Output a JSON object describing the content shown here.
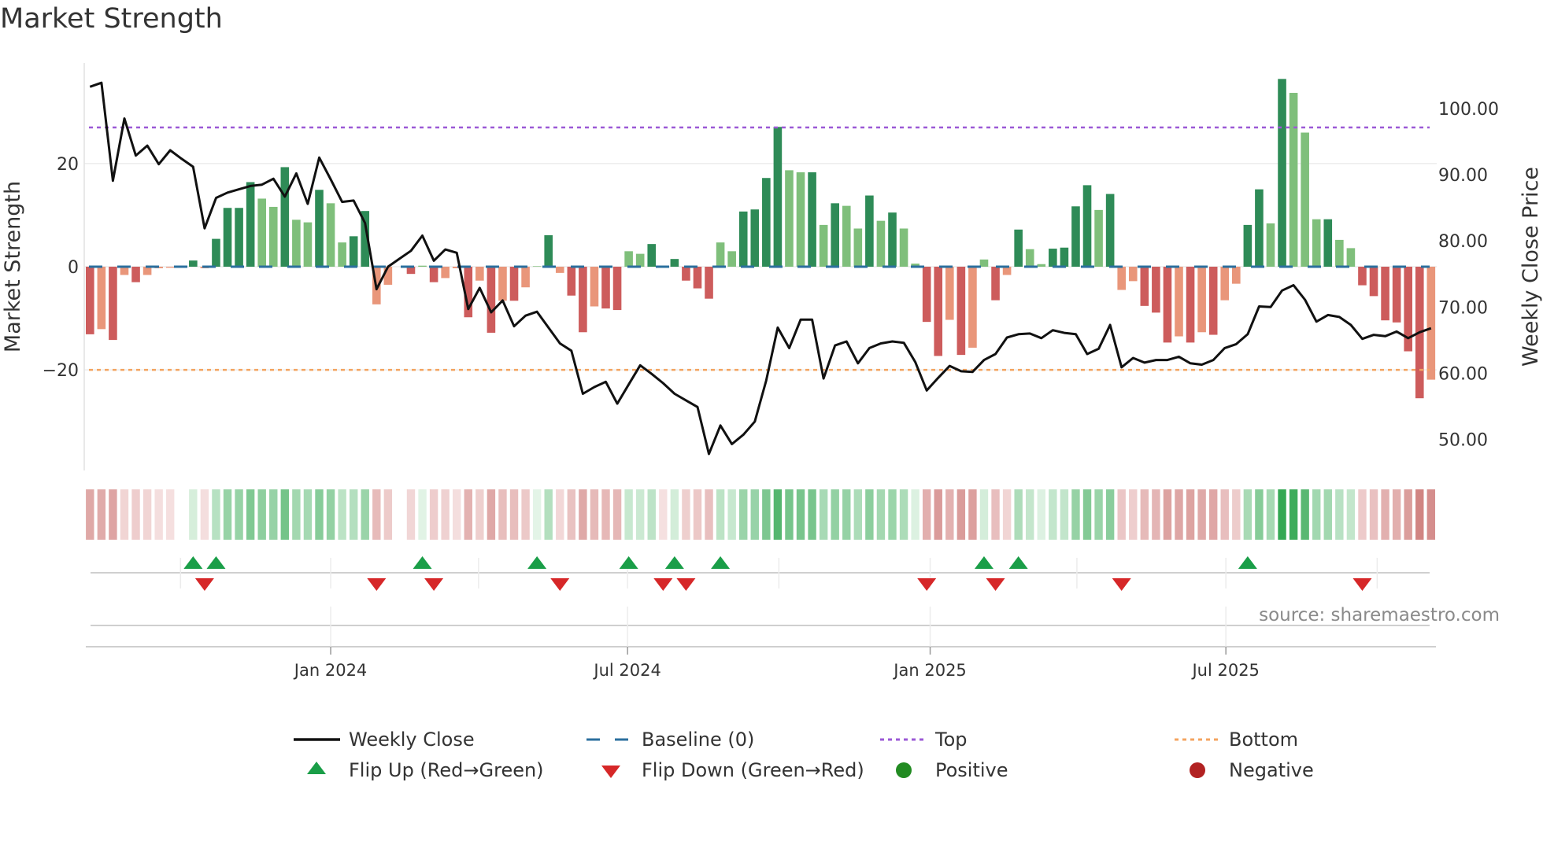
{
  "title": "Market Strength",
  "source": "source: sharemaestro.com",
  "colors": {
    "pos_strong": "#2e8b57",
    "pos_weak": "#7fbf7b",
    "neg_strong": "#cd5c5c",
    "neg_weak": "#e9967a",
    "line": "#111111",
    "baseline": "#2b6f9e",
    "top": "#9b59d6",
    "bottom": "#f4a460",
    "flip_up": "#1a9e48",
    "flip_down": "#d62728",
    "positive": "#228b22",
    "negative": "#b22222"
  },
  "legend": {
    "weekly_close": "Weekly Close",
    "baseline": "Baseline (0)",
    "top": "Top",
    "bottom": "Bottom",
    "flip_up": "Flip Up (Red→Green)",
    "flip_down": "Flip Down (Green→Red)",
    "positive": "Positive",
    "negative": "Negative"
  },
  "chart_data": {
    "type": "bar+line",
    "title": "Market Strength",
    "ylabel": "Market Strength",
    "ylabel_right": "Weekly Close Price",
    "ylim": [
      -39.5,
      39.5
    ],
    "ylim_right": [
      45.3,
      106.9
    ],
    "yticks": [
      20,
      0,
      -20
    ],
    "ytick_labels": [
      "20",
      "0",
      "−20"
    ],
    "yticks_right": [
      100,
      90,
      80,
      70,
      60,
      50
    ],
    "ytick_labels_right": [
      "100.00",
      "90.00",
      "80.00",
      "70.00",
      "60.00",
      "50.00"
    ],
    "top_level": 27,
    "bottom_level": -20,
    "baseline": 0,
    "x_unit": "week index",
    "xticks": [
      21.0,
      46.9,
      73.3,
      99.1
    ],
    "xtick_labels": [
      "Jan 2024",
      "Jul 2024",
      "Jan 2025",
      "Jul 2025"
    ],
    "quarter_marks": [
      7.9,
      33.9,
      60.1,
      86.1,
      112.3
    ],
    "strength": [
      -13.1,
      -12.1,
      -14.2,
      -1.6,
      -3.0,
      -1.6,
      -0.3,
      -0.2,
      0,
      1.2,
      -0.3,
      5.4,
      11.4,
      11.4,
      16.4,
      13.2,
      11.6,
      19.3,
      9.1,
      8.6,
      14.9,
      12.3,
      4.7,
      5.9,
      10.8,
      -7.3,
      -3.5,
      0,
      -1.4,
      0.2,
      -3.0,
      -2.2,
      -0.3,
      -9.8,
      -2.7,
      -12.8,
      -6.6,
      -6.6,
      -4.0,
      0.1,
      6.1,
      -1.2,
      -5.6,
      -12.7,
      -7.7,
      -8.1,
      -8.4,
      3.0,
      2.5,
      4.4,
      -0.1,
      1.5,
      -2.7,
      -4.2,
      -6.2,
      4.7,
      3.0,
      10.7,
      11.1,
      17.2,
      27.1,
      18.7,
      18.3,
      18.3,
      8.1,
      12.3,
      11.8,
      7.4,
      13.8,
      8.9,
      10.5,
      7.4,
      0.6,
      -10.7,
      -17.3,
      -10.3,
      -17.1,
      -15.7,
      1.4,
      -6.5,
      -1.6,
      7.2,
      3.4,
      0.5,
      3.5,
      3.7,
      11.7,
      15.8,
      11.0,
      14.1,
      -4.5,
      -2.8,
      -7.6,
      -8.9,
      -14.7,
      -13.5,
      -14.7,
      -12.7,
      -13.2,
      -6.5,
      -3.3,
      8.1,
      15.0,
      8.4,
      36.4,
      33.7,
      26.0,
      9.2,
      9.2,
      5.2,
      3.6,
      -3.6,
      -5.7,
      -10.4,
      -10.8,
      -16.4,
      -25.5,
      -21.9
    ],
    "weekly_close": [
      103.3,
      103.9,
      89.1,
      98.5,
      92.9,
      94.4,
      91.6,
      93.7,
      92.4,
      91.2,
      81.9,
      86.5,
      87.3,
      87.8,
      88.3,
      88.5,
      89.4,
      86.7,
      90.2,
      85.6,
      92.6,
      89.3,
      85.9,
      86.1,
      82.7,
      72.7,
      76.1,
      77.3,
      78.5,
      80.8,
      77.0,
      78.7,
      78.2,
      69.7,
      72.9,
      69.2,
      71.0,
      67.1,
      68.7,
      69.3,
      66.9,
      64.5,
      63.4,
      56.9,
      57.9,
      58.7,
      55.4,
      58.3,
      61.2,
      59.9,
      58.5,
      56.9,
      55.9,
      54.9,
      47.8,
      52.1,
      49.3,
      50.7,
      52.7,
      58.9,
      66.9,
      63.8,
      68.1,
      68.1,
      59.2,
      64.2,
      64.8,
      61.5,
      63.8,
      64.5,
      64.8,
      64.6,
      61.7,
      57.4,
      59.3,
      61.1,
      60.3,
      60.2,
      62.0,
      62.9,
      65.4,
      65.9,
      66.0,
      65.3,
      66.5,
      66.1,
      65.9,
      62.9,
      63.7,
      67.3,
      60.9,
      62.3,
      61.6,
      62.0,
      62.0,
      62.5,
      61.5,
      61.3,
      62.0,
      63.8,
      64.4,
      65.9,
      70.1,
      70.0,
      72.5,
      73.3,
      71.1,
      67.8,
      68.8,
      68.5,
      67.3,
      65.2,
      65.8,
      65.6,
      66.3,
      65.3,
      66.2,
      66.8
    ]
  }
}
